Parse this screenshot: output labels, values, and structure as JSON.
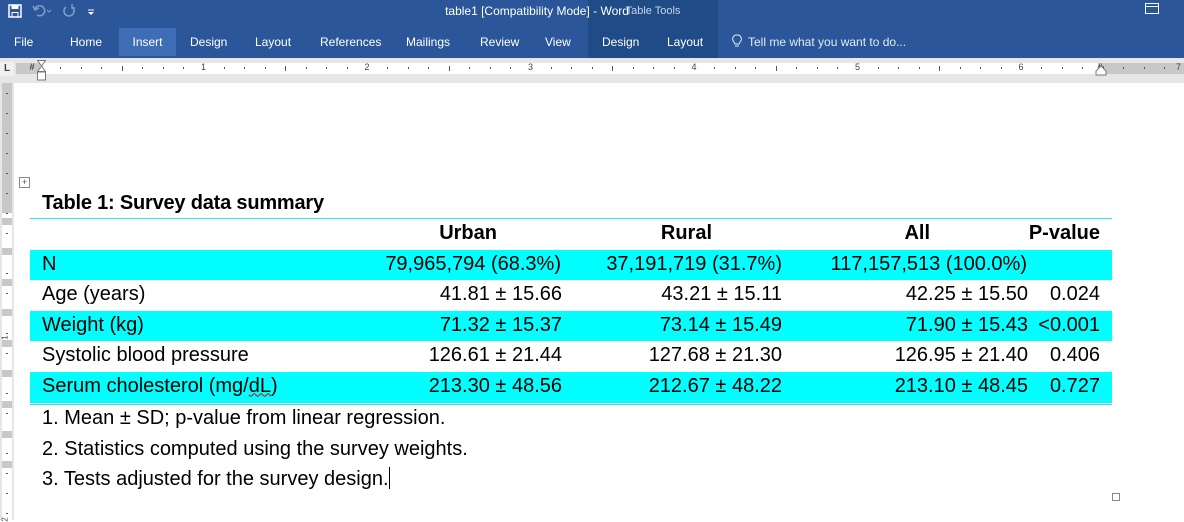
{
  "window": {
    "title": "table1 [Compatibility Mode] - Word",
    "contextual_group": "Table Tools"
  },
  "quick_access": {
    "save_icon": "save-icon",
    "undo_icon": "undo-icon",
    "redo_icon": "redo-icon",
    "customize_icon": "customize-qat-icon"
  },
  "ribbon": {
    "tabs": [
      {
        "label": "File",
        "active": false
      },
      {
        "label": "Home",
        "active": false
      },
      {
        "label": "Insert",
        "active": true
      },
      {
        "label": "Design",
        "active": false
      },
      {
        "label": "Layout",
        "active": false
      },
      {
        "label": "References",
        "active": false
      },
      {
        "label": "Mailings",
        "active": false
      },
      {
        "label": "Review",
        "active": false
      },
      {
        "label": "View",
        "active": false
      }
    ],
    "contextual_tabs": [
      {
        "label": "Design"
      },
      {
        "label": "Layout"
      }
    ],
    "tell_me": "Tell me what you want to do..."
  },
  "ruler": {
    "numbers": [
      "1",
      "2",
      "3",
      "4",
      "5",
      "6",
      "7"
    ],
    "vertical_numbers": [
      "1",
      "2"
    ]
  },
  "document": {
    "caption": "Table 1: Survey data summary",
    "table": {
      "headers": [
        "",
        "Urban",
        "Rural",
        "All",
        "P-value"
      ],
      "rows": [
        {
          "label": "N",
          "urban": "79,965,794 (68.3%)",
          "rural": "37,191,719 (31.7%)",
          "all": "117,157,513 (100.0%)",
          "p": "",
          "shaded": true
        },
        {
          "label": "Age (years)",
          "urban": "41.81 ± 15.66",
          "rural": "43.21 ± 15.11",
          "all": "42.25 ± 15.50",
          "p": "0.024",
          "shaded": false
        },
        {
          "label": "Weight (kg)",
          "urban": "71.32 ± 15.37",
          "rural": "73.14 ± 15.49",
          "all": "71.90 ± 15.43",
          "p": "<0.001",
          "shaded": true
        },
        {
          "label": "Systolic blood pressure",
          "urban": "126.61 ± 21.44",
          "rural": "127.68 ± 21.30",
          "all": "126.95 ± 21.40",
          "p": "0.406",
          "shaded": false
        },
        {
          "label_prefix": "Serum cholesterol (mg/",
          "label_spell": "dL",
          "label_suffix": ")",
          "urban": "213.30 ± 48.56",
          "rural": "212.67 ± 48.22",
          "all": "213.10 ± 48.45",
          "p": "0.727",
          "shaded": true
        }
      ],
      "shade_color": "#00ffff",
      "border_color": "#27e6f0"
    },
    "notes": [
      "1. Mean ± SD; p-value from linear regression.",
      "2. Statistics computed using the survey weights.",
      "3. Tests adjusted for the survey design."
    ]
  },
  "colors": {
    "ribbon_bg": "#2b579a",
    "contextual_bg": "#1f4b87",
    "active_tab_bg": "#3e6db5"
  }
}
